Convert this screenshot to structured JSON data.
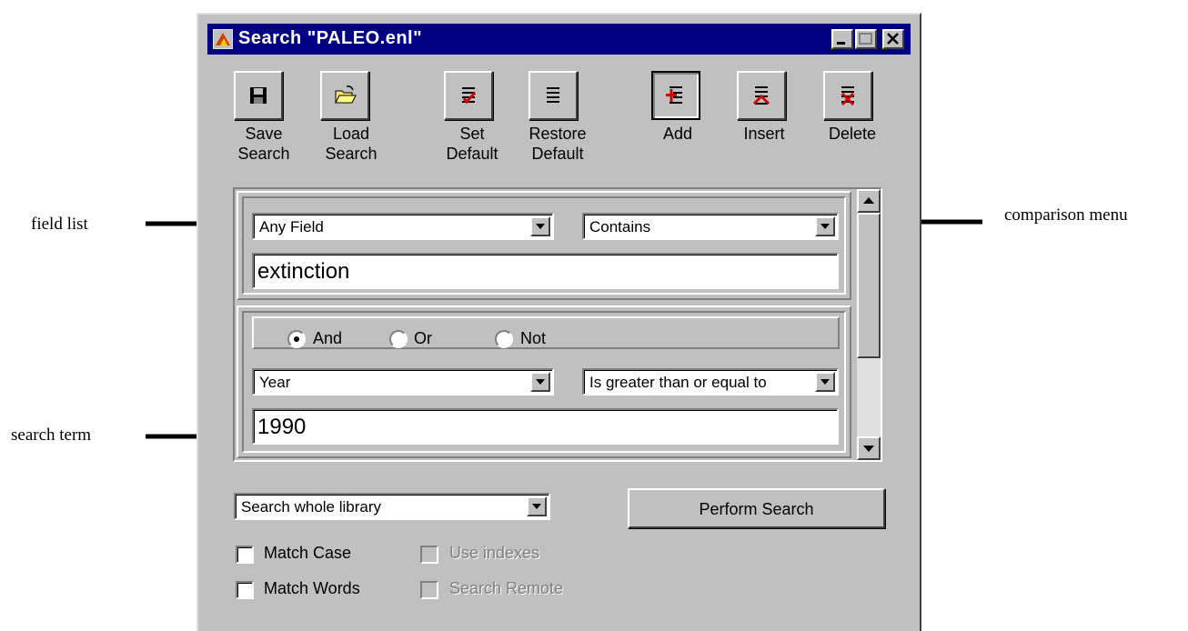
{
  "annotations": {
    "field_list": "field list",
    "comparison_menu": "comparison menu",
    "search_term": "search term"
  },
  "window": {
    "title": "Search \"PALEO.enl\"",
    "buttons": {
      "minimize": "minimize-icon",
      "maximize": "maximize-icon",
      "close": "close-icon"
    }
  },
  "toolbar": {
    "save": {
      "line1": "Save",
      "line2": "Search",
      "icon": "floppy-disk-icon"
    },
    "load": {
      "line1": "Load",
      "line2": "Search",
      "icon": "open-folder-icon"
    },
    "set_default": {
      "line1": "Set",
      "line2": "Default",
      "icon": "list-check-icon"
    },
    "restore_default": {
      "line1": "Restore",
      "line2": "Default",
      "icon": "list-icon"
    },
    "add": {
      "label": "Add",
      "icon": "add-row-icon"
    },
    "insert": {
      "label": "Insert",
      "icon": "insert-row-icon"
    },
    "delete": {
      "label": "Delete",
      "icon": "delete-row-icon"
    }
  },
  "criteria": [
    {
      "field": "Any Field",
      "comparison": "Contains",
      "term": "extinction"
    },
    {
      "connector_options": [
        "And",
        "Or",
        "Not"
      ],
      "connector_selected": "And",
      "field": "Year",
      "comparison": "Is greater than or equal to",
      "term": "1990"
    }
  ],
  "scope": {
    "value": "Search whole library"
  },
  "perform_label": "Perform Search",
  "options": {
    "match_case": {
      "label": "Match Case",
      "checked": false,
      "enabled": true
    },
    "match_words": {
      "label": "Match Words",
      "checked": false,
      "enabled": true
    },
    "use_indexes": {
      "label": "Use indexes",
      "checked": false,
      "enabled": false
    },
    "search_remote": {
      "label": "Search Remote",
      "checked": false,
      "enabled": false
    }
  },
  "colors": {
    "title_bar": "#000080",
    "face": "#c0c0c0",
    "accent_red": "#cc0000"
  }
}
